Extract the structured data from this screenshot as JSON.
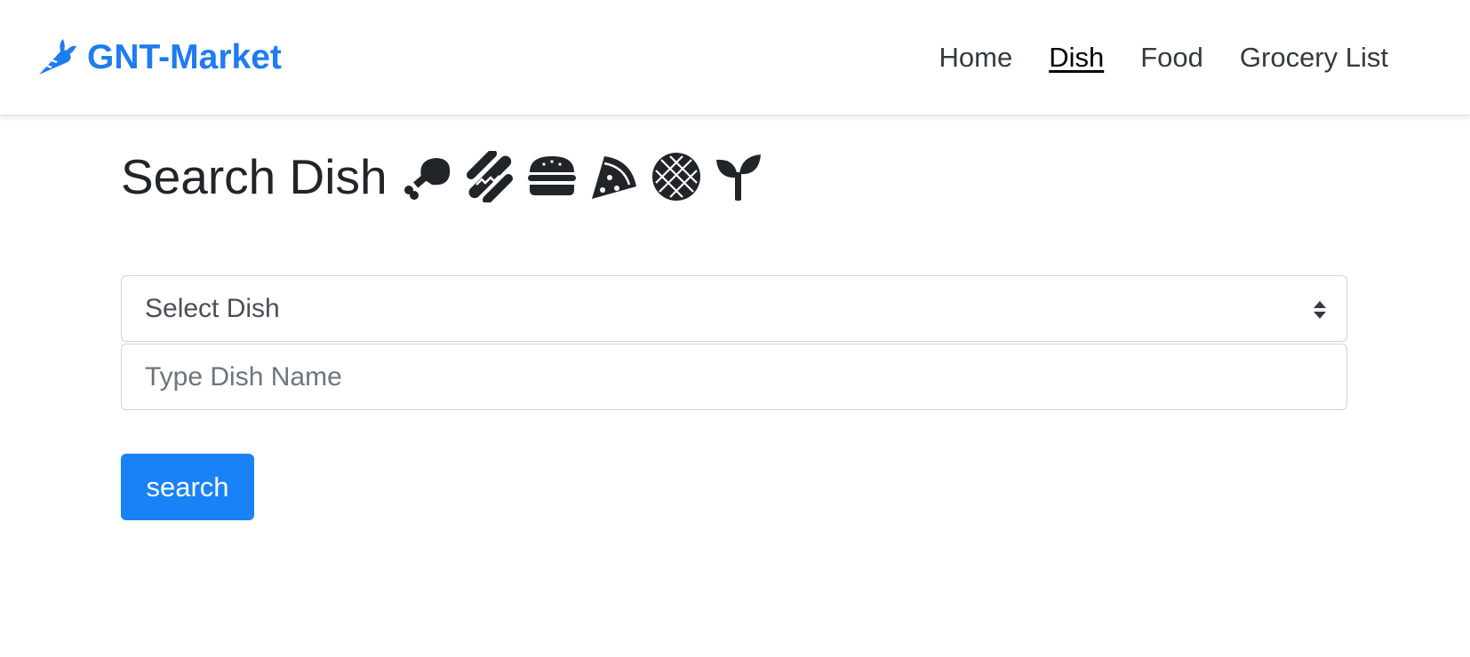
{
  "brand": {
    "name": "GNT-Market",
    "icon": "carrot-icon",
    "color": "#1e7cf2"
  },
  "nav": {
    "items": [
      {
        "label": "Home",
        "active": false
      },
      {
        "label": "Dish",
        "active": true
      },
      {
        "label": "Food",
        "active": false
      },
      {
        "label": "Grocery List",
        "active": false
      }
    ]
  },
  "main": {
    "title": "Search Dish",
    "title_icons": [
      "drumstick-icon",
      "hotdog-icon",
      "hamburger-icon",
      "pizza-slice-icon",
      "pie-icon",
      "seedling-icon"
    ],
    "select": {
      "selected": "Select Dish"
    },
    "input": {
      "placeholder": "Type Dish Name",
      "value": ""
    },
    "button": {
      "label": "search",
      "color": "#1a82f7"
    }
  }
}
